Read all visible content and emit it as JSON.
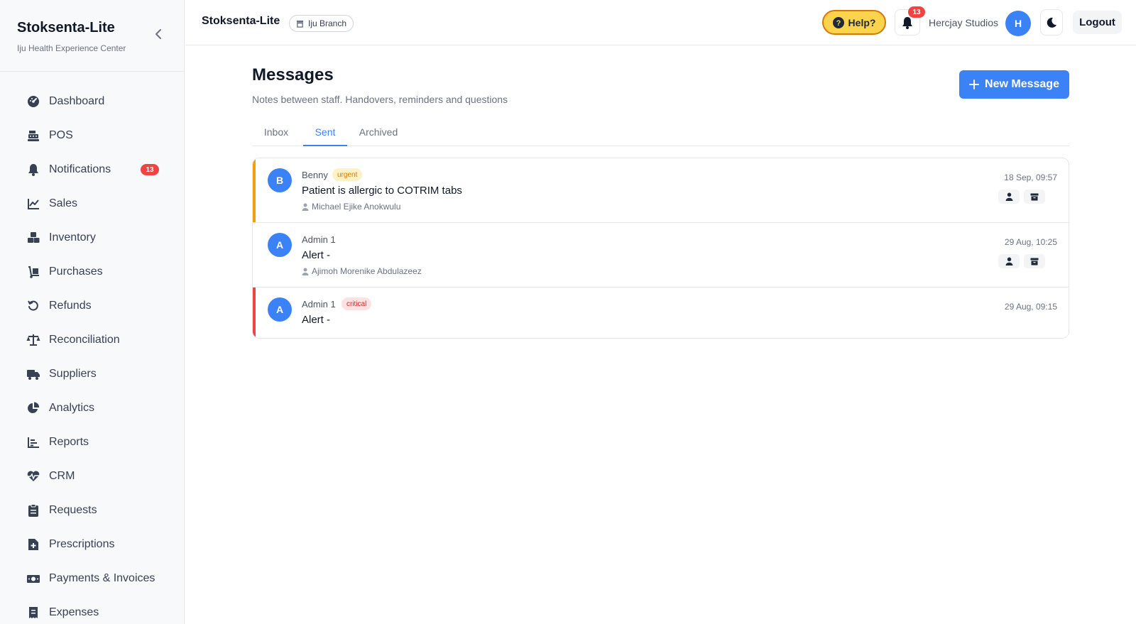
{
  "sidebar": {
    "title": "Stoksenta-Lite",
    "subtitle": "Iju Health Experience Center",
    "items": [
      {
        "label": "Dashboard",
        "icon": "dashboard-icon"
      },
      {
        "label": "POS",
        "icon": "cash-register-icon"
      },
      {
        "label": "Notifications",
        "icon": "bell-icon",
        "badge": "13"
      },
      {
        "label": "Sales",
        "icon": "line-chart-icon"
      },
      {
        "label": "Inventory",
        "icon": "boxes-icon"
      },
      {
        "label": "Purchases",
        "icon": "dolly-icon"
      },
      {
        "label": "Refunds",
        "icon": "undo-icon"
      },
      {
        "label": "Reconciliation",
        "icon": "scale-icon"
      },
      {
        "label": "Suppliers",
        "icon": "truck-icon"
      },
      {
        "label": "Analytics",
        "icon": "pie-chart-icon"
      },
      {
        "label": "Reports",
        "icon": "bar-chart-icon"
      },
      {
        "label": "CRM",
        "icon": "heartbeat-icon"
      },
      {
        "label": "Requests",
        "icon": "clipboard-icon"
      },
      {
        "label": "Prescriptions",
        "icon": "medical-file-icon"
      },
      {
        "label": "Payments & Invoices",
        "icon": "money-icon"
      },
      {
        "label": "Expenses",
        "icon": "receipt-icon"
      }
    ]
  },
  "header": {
    "title": "Stoksenta-Lite",
    "branch": "Iju Branch",
    "help_label": "Help?",
    "notification_count": "13",
    "user_name": "Hercjay Studios",
    "avatar_initial": "H",
    "logout_label": "Logout"
  },
  "main": {
    "title": "Messages",
    "subtitle": "Notes between staff. Handovers, reminders and questions",
    "new_button_label": "New Message",
    "tabs": [
      {
        "label": "Inbox",
        "active": false
      },
      {
        "label": "Sent",
        "active": true
      },
      {
        "label": "Archived",
        "active": false
      }
    ],
    "messages": [
      {
        "initial": "B",
        "sender": "Benny",
        "tag": "urgent",
        "subject": "Patient is allergic to COTRIM tabs",
        "recipient": "Michael Ejike Anokwulu",
        "time": "18 Sep, 09:57",
        "accent": "#f59e0b"
      },
      {
        "initial": "A",
        "sender": "Admin 1",
        "tag": "",
        "subject": "Alert -",
        "recipient": "Ajimoh Morenike Abdulazeez",
        "time": "29 Aug, 10:25",
        "accent": ""
      },
      {
        "initial": "A",
        "sender": "Admin 1",
        "tag": "critical",
        "subject": "Alert -",
        "recipient": "",
        "time": "29 Aug, 09:15",
        "accent": "#ef4444"
      }
    ]
  },
  "colors": {
    "primary": "#3b82f6",
    "help_bg": "#fcd34d",
    "badge": "#ef4444",
    "urgent": "#f59e0b",
    "critical": "#ef4444"
  }
}
